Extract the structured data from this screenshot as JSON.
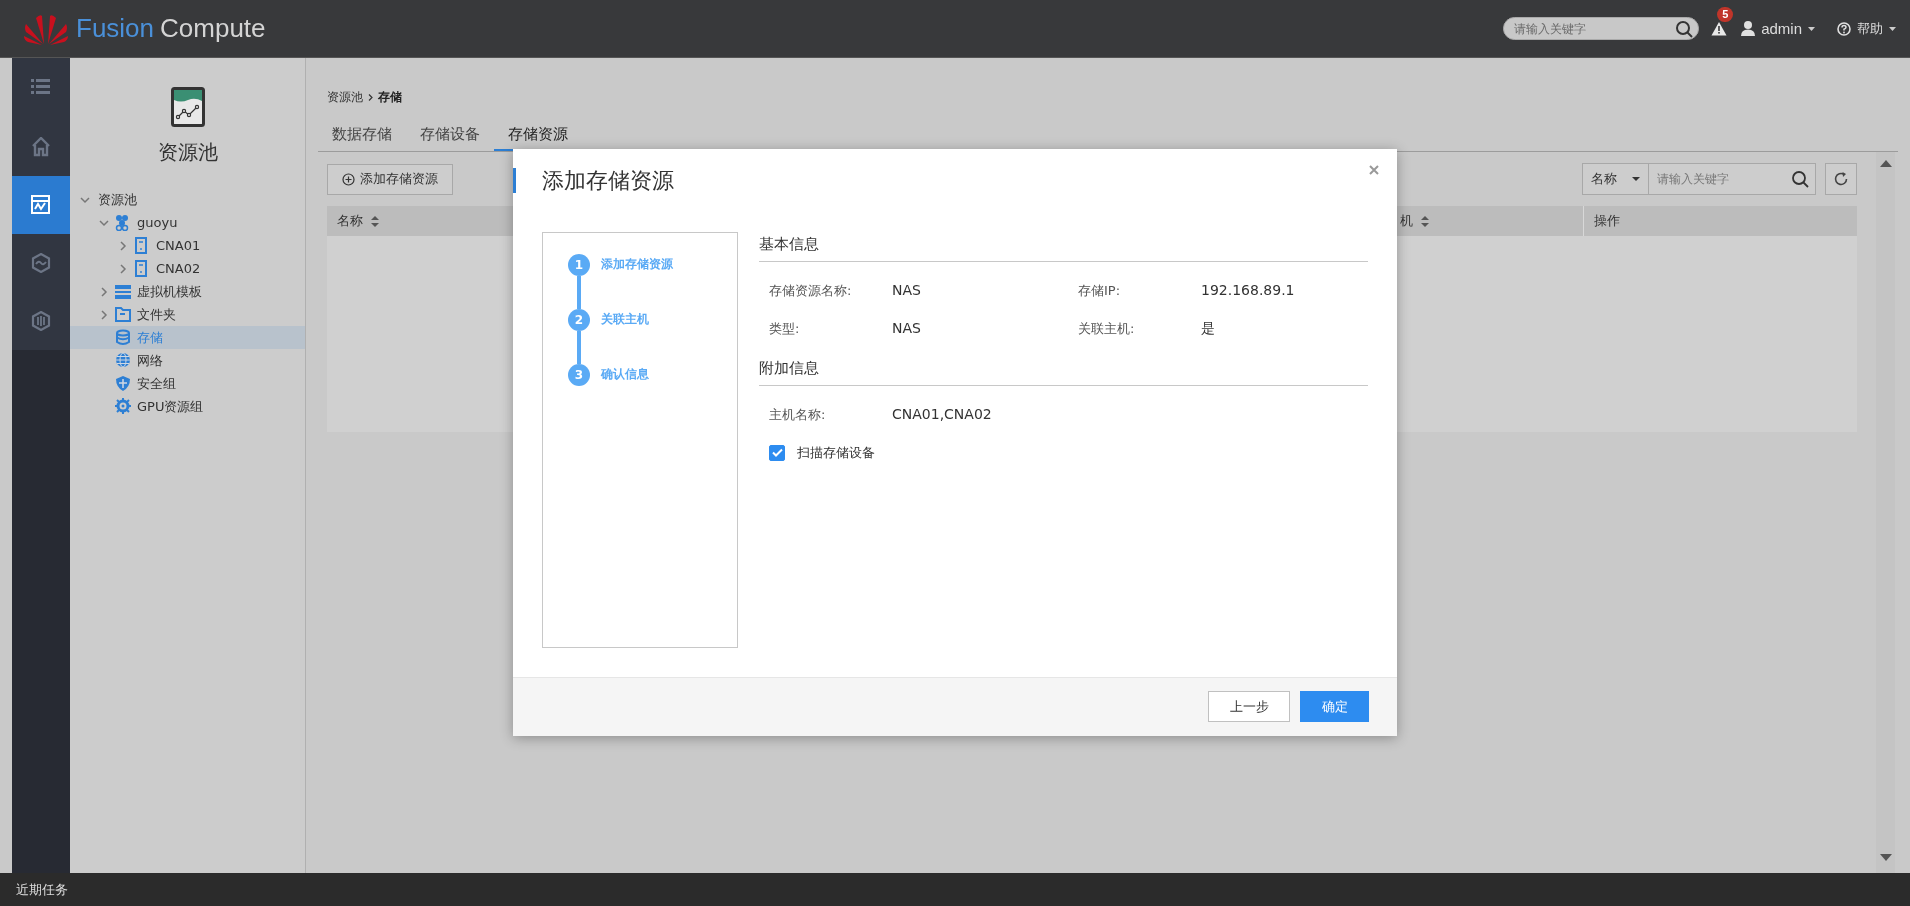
{
  "header": {
    "brand_first": "Fusion",
    "brand_second": "Compute",
    "search": {
      "placeholder": "请输入关键字"
    },
    "alert_count": "5",
    "user": "admin",
    "help": "帮助"
  },
  "nav_rail": [
    {
      "kind": "list",
      "selected": false
    },
    {
      "kind": "home",
      "selected": false
    },
    {
      "kind": "resource",
      "selected": true
    },
    {
      "kind": "cloud",
      "selected": false
    },
    {
      "kind": "gpu",
      "selected": false
    }
  ],
  "tree_panel": {
    "title": "资源池",
    "tree": [
      {
        "label": "资源池",
        "expanded": true,
        "selected": false,
        "children": [
          {
            "label": "guoyu",
            "kind": "cluster",
            "expanded": true,
            "selected": false,
            "children": [
              {
                "label": "CNA01",
                "kind": "host",
                "expanded": false,
                "selected": false
              },
              {
                "label": "CNA02",
                "kind": "host",
                "expanded": false,
                "selected": false
              }
            ]
          },
          {
            "label": "虚拟机模板",
            "kind": "template",
            "expanded": false,
            "selected": false
          },
          {
            "label": "文件夹",
            "kind": "folder",
            "expanded": false,
            "selected": false
          },
          {
            "label": "存储",
            "kind": "storage",
            "selected": true
          },
          {
            "label": "网络",
            "kind": "network",
            "selected": false
          },
          {
            "label": "安全组",
            "kind": "security",
            "selected": false
          },
          {
            "label": "GPU资源组",
            "kind": "gpu",
            "selected": false
          }
        ]
      }
    ]
  },
  "breadcrumb": [
    "资源池",
    "存储"
  ],
  "tabs": [
    {
      "label": "数据存储",
      "selected": false
    },
    {
      "label": "存储设备",
      "selected": false
    },
    {
      "label": "存储资源",
      "selected": true
    }
  ],
  "toolbar": {
    "add_button": "添加存储资源",
    "filter": {
      "field": "名称",
      "placeholder": "请输入关键字"
    }
  },
  "table": {
    "columns": [
      {
        "label": "名称",
        "sortable": true
      },
      {
        "label": "机",
        "sortable": true
      },
      {
        "label": "操作",
        "sortable": false
      }
    ]
  },
  "dialog": {
    "title": "添加存储资源",
    "steps": [
      {
        "number": "1",
        "label": "添加存储资源"
      },
      {
        "number": "2",
        "label": "关联主机"
      },
      {
        "number": "3",
        "label": "确认信息"
      }
    ],
    "sections": [
      {
        "title": "基本信息",
        "fields": [
          {
            "label": "存储资源名称:",
            "value": "NAS"
          },
          {
            "label": "存储IP:",
            "value": "192.168.89.1"
          },
          {
            "label": "类型:",
            "value": "NAS"
          },
          {
            "label": "关联主机:",
            "value": "是"
          }
        ]
      },
      {
        "title": "附加信息",
        "fields": [
          {
            "label": "主机名称:",
            "value": "CNA01,CNA02"
          }
        ]
      }
    ],
    "checkbox": {
      "label": "扫描存储设备",
      "checked": true
    },
    "buttons": [
      {
        "label": "上一步",
        "kind": "secondary"
      },
      {
        "label": "确定",
        "kind": "primary"
      }
    ]
  },
  "status_bar": {
    "label": "近期任务"
  }
}
